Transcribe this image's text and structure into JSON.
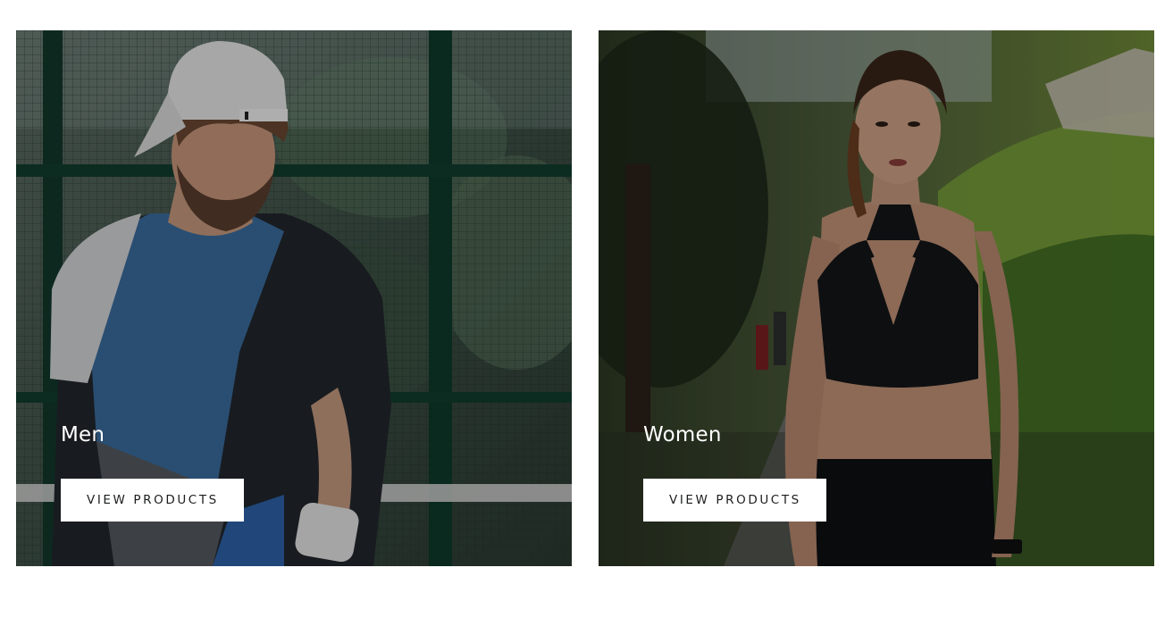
{
  "collections": [
    {
      "title": "Men",
      "button_label": "VIEW PRODUCTS",
      "image_subject": "man in tennis cap and color-block t-shirt by court fence"
    },
    {
      "title": "Women",
      "button_label": "VIEW PRODUCTS",
      "image_subject": "woman in black sports bra and leggings on park path"
    }
  ],
  "colors": {
    "page_background": "#ffffff",
    "button_background": "#ffffff",
    "button_text": "#1c1d1d",
    "title_text": "#ffffff"
  }
}
